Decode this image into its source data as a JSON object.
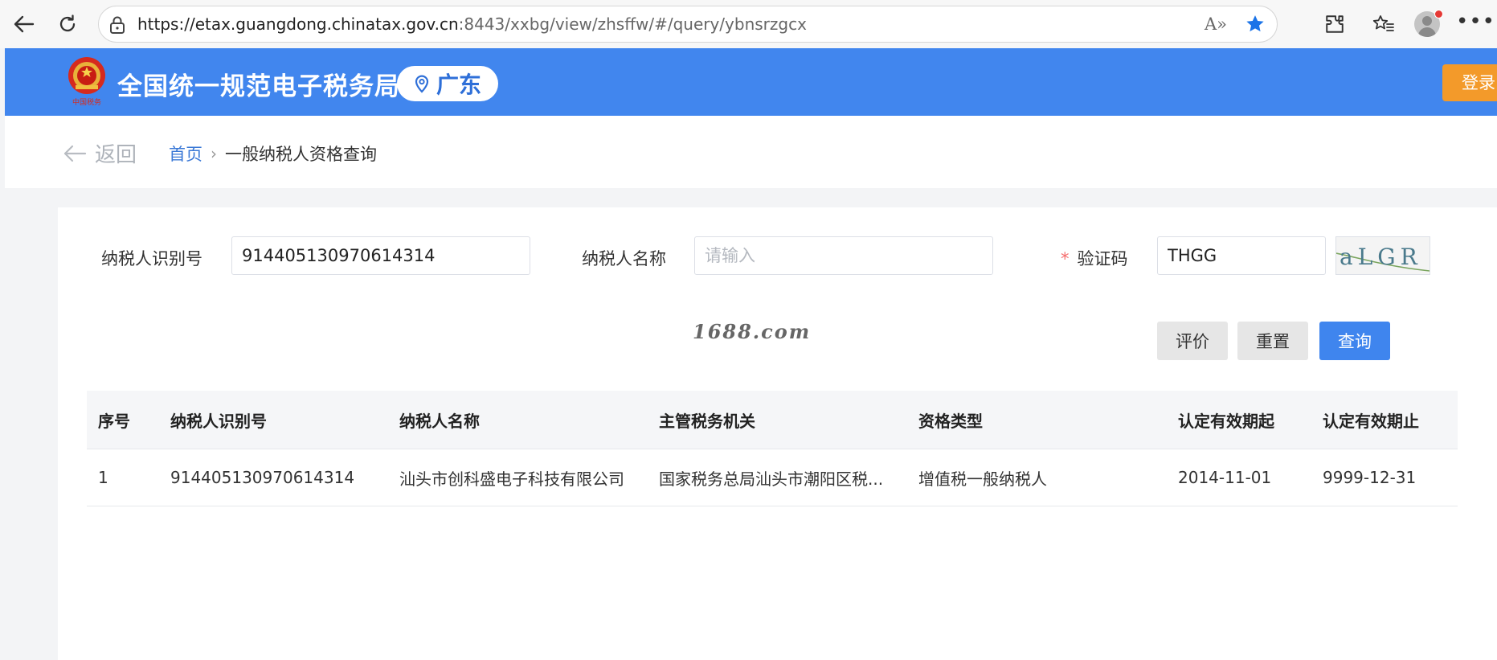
{
  "browser": {
    "url_host": "https://etax.guangdong.chinatax.gov.cn",
    "url_rest": ":8443/xxbg/view/zhsffw/#/query/ybnsrzgcx",
    "read_aloud_label": "A»"
  },
  "header": {
    "site_title": "全国统一规范电子税务局",
    "region": "广东",
    "login_label": "登录",
    "emblem_text": "中国税务"
  },
  "breadcrumb": {
    "back_label": "返回",
    "home": "首页",
    "current": "一般纳税人资格查询"
  },
  "form": {
    "taxpayer_id_label": "纳税人识别号",
    "taxpayer_id_value": "914405130970614314",
    "taxpayer_name_label": "纳税人名称",
    "taxpayer_name_placeholder": "请输入",
    "captcha_label": "验证码",
    "captcha_required_mark": "*",
    "captcha_value": "THGG",
    "captcha_image_text": "aLGR",
    "watermark": "1688.com"
  },
  "buttons": {
    "evaluate": "评价",
    "reset": "重置",
    "query": "查询"
  },
  "table": {
    "headers": [
      "序号",
      "纳税人识别号",
      "纳税人名称",
      "主管税务机关",
      "资格类型",
      "认定有效期起",
      "认定有效期止"
    ],
    "rows": [
      [
        "1",
        "914405130970614314",
        "汕头市创科盛电子科技有限公司",
        "国家税务总局汕头市潮阳区税...",
        "增值税一般纳税人",
        "2014-11-01",
        "9999-12-31"
      ]
    ]
  },
  "colors": {
    "header_blue": "#4186ee",
    "primary_button": "#3f85ee",
    "login_orange": "#f39a2a",
    "required_red": "#f56c6c"
  }
}
